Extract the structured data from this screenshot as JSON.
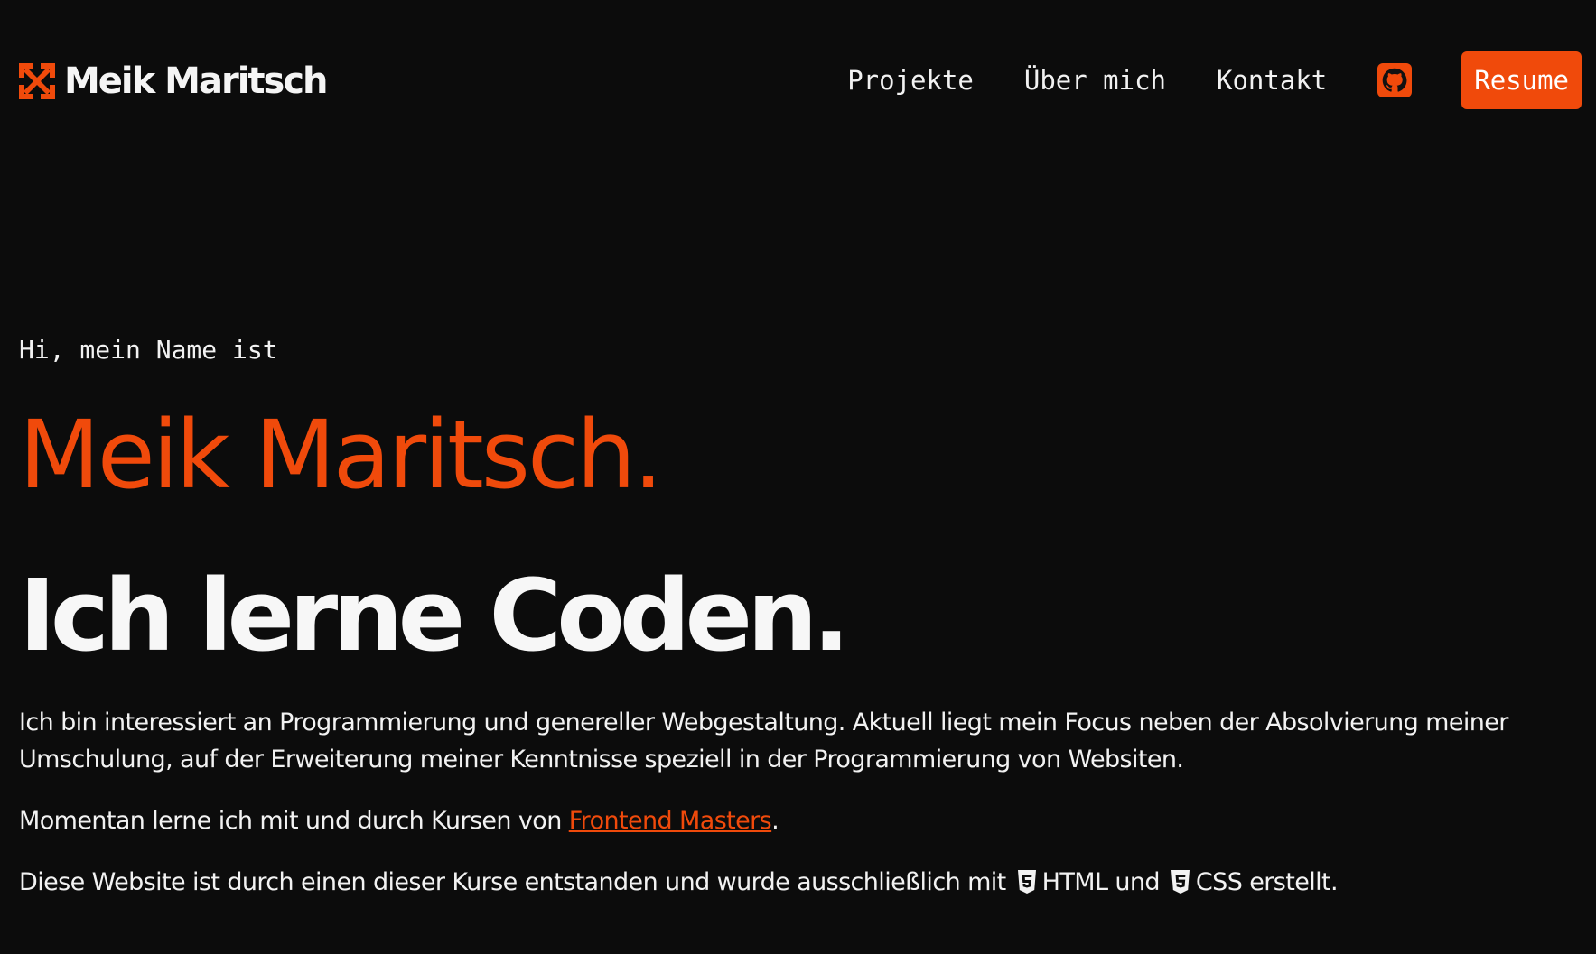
{
  "header": {
    "brand_name": "Meik Maritsch",
    "nav": {
      "projects": "Projekte",
      "about": "Über mich",
      "contact": "Kontakt",
      "github_icon": "github-icon",
      "resume": "Resume"
    }
  },
  "hero": {
    "greeting": "Hi, mein Name ist",
    "name": "Meik Maritsch.",
    "tagline": "Ich lerne Coden.",
    "paragraph1": "Ich bin interessiert an Programmierung und genereller Webgestaltung. Aktuell liegt mein Focus neben der Absolvierung meiner Umschulung, auf der Erweiterung meiner Kenntnisse speziell in der Programmierung von Websiten.",
    "paragraph2": {
      "before": "Momentan lerne ich mit und durch Kursen von ",
      "link": "Frontend Masters",
      "after": "."
    },
    "paragraph3": {
      "before": "Diese Website ist durch einen dieser Kurse entstanden und wurde ausschließlich mit ",
      "html_label": "HTML",
      "middle": " und ",
      "css_label": "CSS",
      "after": " erstellt."
    }
  },
  "colors": {
    "background": "#0c0c0c",
    "accent": "#f04a0b",
    "text": "#f2f2f2"
  }
}
